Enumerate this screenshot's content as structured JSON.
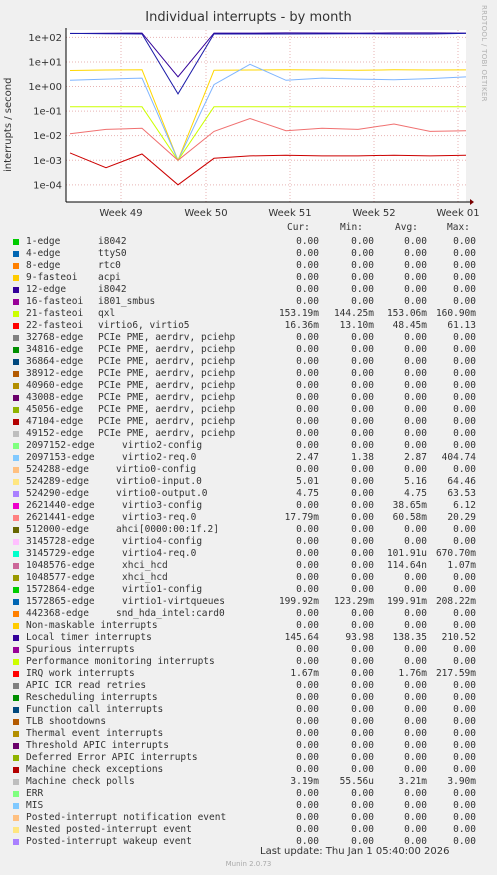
{
  "chart_data": {
    "type": "line",
    "title": "Individual interrupts - by month",
    "ylabel": "interrupts / second",
    "yscale": "log",
    "ylim": [
      2e-05,
      200
    ],
    "y_ticks": [
      "1e+02",
      "1e+01",
      "1e+00",
      "1e-01",
      "1e-02",
      "1e-03",
      "1e-04"
    ],
    "x_ticks": [
      "Week 49",
      "Week 50",
      "Week 51",
      "Week 52",
      "Week 01"
    ],
    "grid": true,
    "series": [
      {
        "name": "12-edge i8042",
        "color": "#330099",
        "values": [
          144,
          148,
          150,
          2.5,
          150,
          150,
          152,
          151,
          150,
          153,
          152,
          150
        ]
      },
      {
        "name": "Local timer interrupts",
        "color": "#1a1aa8",
        "values": [
          145,
          140,
          138,
          0.5,
          139,
          138,
          137,
          139,
          140,
          138,
          138,
          145.64
        ]
      },
      {
        "name": "2621441-edge virtio3-req.0",
        "color": "#ffd700",
        "values": [
          4.5,
          4.7,
          4.8,
          0.001,
          4.6,
          4.7,
          4.8,
          4.7,
          4.6,
          4.8,
          4.7,
          4.75
        ]
      },
      {
        "name": "2097153-edge virtio2-req.0",
        "color": "#7fb5ff",
        "values": [
          1.8,
          2.0,
          2.2,
          0.001,
          1.2,
          8,
          1.8,
          2.2,
          2.0,
          1.9,
          2.1,
          2.47
        ]
      },
      {
        "name": "21-fasteoi qxl",
        "color": "#ccff00",
        "values": [
          0.15,
          0.15,
          0.15,
          0.001,
          0.15,
          0.15,
          0.15,
          0.15,
          0.15,
          0.15,
          0.15,
          0.15
        ]
      },
      {
        "name": "22-fasteoi virtio6, virtio5",
        "color": "#f07070",
        "values": [
          0.012,
          0.018,
          0.02,
          0.001,
          0.015,
          0.05,
          0.016,
          0.02,
          0.018,
          0.03,
          0.015,
          0.016
        ]
      },
      {
        "name": "Machine check polls",
        "color": "#cc0000",
        "values": [
          0.002,
          0.0005,
          0.0018,
          0.0001,
          0.0012,
          0.0015,
          0.0016,
          0.0015,
          0.0015,
          0.0016,
          0.0015,
          0.0016
        ]
      }
    ]
  },
  "side_text": "RRDTOOL / TOBI OETIKER",
  "legend": {
    "headers": {
      "cur": "Cur:",
      "min": "Min:",
      "avg": "Avg:",
      "max": "Max:"
    },
    "rows": [
      {
        "label": "1-edge",
        "device": "i8042",
        "color": "#00cc00",
        "cur": "0.00",
        "min": "0.00",
        "avg": "0.00",
        "max": "0.00"
      },
      {
        "label": "4-edge",
        "device": "ttyS0",
        "color": "#0066b3",
        "cur": "0.00",
        "min": "0.00",
        "avg": "0.00",
        "max": "0.00"
      },
      {
        "label": "8-edge",
        "device": "rtc0",
        "color": "#ff8000",
        "cur": "0.00",
        "min": "0.00",
        "avg": "0.00",
        "max": "0.00"
      },
      {
        "label": "9-fasteoi",
        "device": "acpi",
        "color": "#ffcc00",
        "cur": "0.00",
        "min": "0.00",
        "avg": "0.00",
        "max": "0.00"
      },
      {
        "label": "12-edge",
        "device": "i8042",
        "color": "#330099",
        "cur": "0.00",
        "min": "0.00",
        "avg": "0.00",
        "max": "0.00"
      },
      {
        "label": "16-fasteoi",
        "device": "i801_smbus",
        "color": "#990099",
        "cur": "0.00",
        "min": "0.00",
        "avg": "0.00",
        "max": "0.00"
      },
      {
        "label": "21-fasteoi",
        "device": "qxl",
        "color": "#ccff00",
        "cur": "153.19m",
        "min": "144.25m",
        "avg": "153.06m",
        "max": "160.90m"
      },
      {
        "label": "22-fasteoi",
        "device": "virtio6, virtio5",
        "color": "#ff0000",
        "cur": "16.36m",
        "min": "13.10m",
        "avg": "48.45m",
        "max": "61.13"
      },
      {
        "label": "32768-edge",
        "device": "PCIe PME, aerdrv, pciehp",
        "color": "#808080",
        "cur": "0.00",
        "min": "0.00",
        "avg": "0.00",
        "max": "0.00"
      },
      {
        "label": "34816-edge",
        "device": "PCIe PME, aerdrv, pciehp",
        "color": "#008f00",
        "cur": "0.00",
        "min": "0.00",
        "avg": "0.00",
        "max": "0.00"
      },
      {
        "label": "36864-edge",
        "device": "PCIe PME, aerdrv, pciehp",
        "color": "#00487d",
        "cur": "0.00",
        "min": "0.00",
        "avg": "0.00",
        "max": "0.00"
      },
      {
        "label": "38912-edge",
        "device": "PCIe PME, aerdrv, pciehp",
        "color": "#b35a00",
        "cur": "0.00",
        "min": "0.00",
        "avg": "0.00",
        "max": "0.00"
      },
      {
        "label": "40960-edge",
        "device": "PCIe PME, aerdrv, pciehp",
        "color": "#b38f00",
        "cur": "0.00",
        "min": "0.00",
        "avg": "0.00",
        "max": "0.00"
      },
      {
        "label": "43008-edge",
        "device": "PCIe PME, aerdrv, pciehp",
        "color": "#6b006b",
        "cur": "0.00",
        "min": "0.00",
        "avg": "0.00",
        "max": "0.00"
      },
      {
        "label": "45056-edge",
        "device": "PCIe PME, aerdrv, pciehp",
        "color": "#8fb300",
        "cur": "0.00",
        "min": "0.00",
        "avg": "0.00",
        "max": "0.00"
      },
      {
        "label": "47104-edge",
        "device": "PCIe PME, aerdrv, pciehp",
        "color": "#b30000",
        "cur": "0.00",
        "min": "0.00",
        "avg": "0.00",
        "max": "0.00"
      },
      {
        "label": "49152-edge",
        "device": "PCIe PME, aerdrv, pciehp",
        "color": "#bebebe",
        "cur": "0.00",
        "min": "0.00",
        "avg": "0.00",
        "max": "0.00"
      },
      {
        "label": "2097152-edge",
        "device": "virtio2-config",
        "color": "#80ff80",
        "cur": "0.00",
        "min": "0.00",
        "avg": "0.00",
        "max": "0.00"
      },
      {
        "label": "2097153-edge",
        "device": "virtio2-req.0",
        "color": "#80c9ff",
        "cur": "2.47",
        "min": "1.38",
        "avg": "2.87",
        "max": "404.74"
      },
      {
        "label": "524288-edge",
        "device": "virtio0-config",
        "color": "#ffc080",
        "cur": "0.00",
        "min": "0.00",
        "avg": "0.00",
        "max": "0.00"
      },
      {
        "label": "524289-edge",
        "device": "virtio0-input.0",
        "color": "#ffe680",
        "cur": "5.01",
        "min": "0.00",
        "avg": "5.16",
        "max": "64.46"
      },
      {
        "label": "524290-edge",
        "device": "virtio0-output.0",
        "color": "#aa80ff",
        "cur": "4.75",
        "min": "0.00",
        "avg": "4.75",
        "max": "63.53"
      },
      {
        "label": "2621440-edge",
        "device": "virtio3-config",
        "color": "#ee00cc",
        "cur": "0.00",
        "min": "0.00",
        "avg": "38.65m",
        "max": "6.12"
      },
      {
        "label": "2621441-edge",
        "device": "virtio3-req.0",
        "color": "#ff8080",
        "cur": "17.79m",
        "min": "0.00",
        "avg": "60.58m",
        "max": "20.29"
      },
      {
        "label": "512000-edge",
        "device": "ahci[0000:00:1f.2]",
        "color": "#666600",
        "cur": "0.00",
        "min": "0.00",
        "avg": "0.00",
        "max": "0.00"
      },
      {
        "label": "3145728-edge",
        "device": "virtio4-config",
        "color": "#ffbfff",
        "cur": "0.00",
        "min": "0.00",
        "avg": "0.00",
        "max": "0.00"
      },
      {
        "label": "3145729-edge",
        "device": "virtio4-req.0",
        "color": "#00ffcc",
        "cur": "0.00",
        "min": "0.00",
        "avg": "101.91u",
        "max": "670.70m"
      },
      {
        "label": "1048576-edge",
        "device": "xhci_hcd",
        "color": "#cc6699",
        "cur": "0.00",
        "min": "0.00",
        "avg": "114.64n",
        "max": "1.07m"
      },
      {
        "label": "1048577-edge",
        "device": "xhci_hcd",
        "color": "#999900",
        "cur": "0.00",
        "min": "0.00",
        "avg": "0.00",
        "max": "0.00"
      },
      {
        "label": "1572864-edge",
        "device": "virtio1-config",
        "color": "#00cc00",
        "cur": "0.00",
        "min": "0.00",
        "avg": "0.00",
        "max": "0.00"
      },
      {
        "label": "1572865-edge",
        "device": "virtio1-virtqueues",
        "color": "#0066b3",
        "cur": "199.92m",
        "min": "123.29m",
        "avg": "199.91m",
        "max": "208.22m"
      },
      {
        "label": "442368-edge",
        "device": "snd_hda_intel:card0",
        "color": "#ff8000",
        "cur": "0.00",
        "min": "0.00",
        "avg": "0.00",
        "max": "0.00"
      },
      {
        "label": "Non-maskable interrupts",
        "device": "",
        "color": "#ffcc00",
        "cur": "0.00",
        "min": "0.00",
        "avg": "0.00",
        "max": "0.00"
      },
      {
        "label": "Local timer interrupts",
        "device": "",
        "color": "#330099",
        "cur": "145.64",
        "min": "93.98",
        "avg": "138.35",
        "max": "210.52"
      },
      {
        "label": "Spurious interrupts",
        "device": "",
        "color": "#990099",
        "cur": "0.00",
        "min": "0.00",
        "avg": "0.00",
        "max": "0.00"
      },
      {
        "label": "Performance monitoring interrupts",
        "device": "",
        "color": "#ccff00",
        "cur": "0.00",
        "min": "0.00",
        "avg": "0.00",
        "max": "0.00"
      },
      {
        "label": "IRQ work interrupts",
        "device": "",
        "color": "#ff0000",
        "cur": "1.67m",
        "min": "0.00",
        "avg": "1.76m",
        "max": "217.59m"
      },
      {
        "label": "APIC ICR read retries",
        "device": "",
        "color": "#808080",
        "cur": "0.00",
        "min": "0.00",
        "avg": "0.00",
        "max": "0.00"
      },
      {
        "label": "Rescheduling interrupts",
        "device": "",
        "color": "#008f00",
        "cur": "0.00",
        "min": "0.00",
        "avg": "0.00",
        "max": "0.00"
      },
      {
        "label": "Function call interrupts",
        "device": "",
        "color": "#00487d",
        "cur": "0.00",
        "min": "0.00",
        "avg": "0.00",
        "max": "0.00"
      },
      {
        "label": "TLB shootdowns",
        "device": "",
        "color": "#b35a00",
        "cur": "0.00",
        "min": "0.00",
        "avg": "0.00",
        "max": "0.00"
      },
      {
        "label": "Thermal event interrupts",
        "device": "",
        "color": "#b38f00",
        "cur": "0.00",
        "min": "0.00",
        "avg": "0.00",
        "max": "0.00"
      },
      {
        "label": "Threshold APIC interrupts",
        "device": "",
        "color": "#6b006b",
        "cur": "0.00",
        "min": "0.00",
        "avg": "0.00",
        "max": "0.00"
      },
      {
        "label": "Deferred Error APIC interrupts",
        "device": "",
        "color": "#8fb300",
        "cur": "0.00",
        "min": "0.00",
        "avg": "0.00",
        "max": "0.00"
      },
      {
        "label": "Machine check exceptions",
        "device": "",
        "color": "#b30000",
        "cur": "0.00",
        "min": "0.00",
        "avg": "0.00",
        "max": "0.00"
      },
      {
        "label": "Machine check polls",
        "device": "",
        "color": "#bebebe",
        "cur": "3.19m",
        "min": "55.56u",
        "avg": "3.21m",
        "max": "3.90m"
      },
      {
        "label": "ERR",
        "device": "",
        "color": "#80ff80",
        "cur": "0.00",
        "min": "0.00",
        "avg": "0.00",
        "max": "0.00"
      },
      {
        "label": "MIS",
        "device": "",
        "color": "#80c9ff",
        "cur": "0.00",
        "min": "0.00",
        "avg": "0.00",
        "max": "0.00"
      },
      {
        "label": "Posted-interrupt notification event",
        "device": "",
        "color": "#ffc080",
        "cur": "0.00",
        "min": "0.00",
        "avg": "0.00",
        "max": "0.00"
      },
      {
        "label": "Nested posted-interrupt event",
        "device": "",
        "color": "#ffe680",
        "cur": "0.00",
        "min": "0.00",
        "avg": "0.00",
        "max": "0.00"
      },
      {
        "label": "Posted-interrupt wakeup event",
        "device": "",
        "color": "#aa80ff",
        "cur": "0.00",
        "min": "0.00",
        "avg": "0.00",
        "max": "0.00"
      }
    ]
  },
  "last_update": "Last update: Thu Jan  1 05:40:00 2026",
  "version": "Munin 2.0.73"
}
